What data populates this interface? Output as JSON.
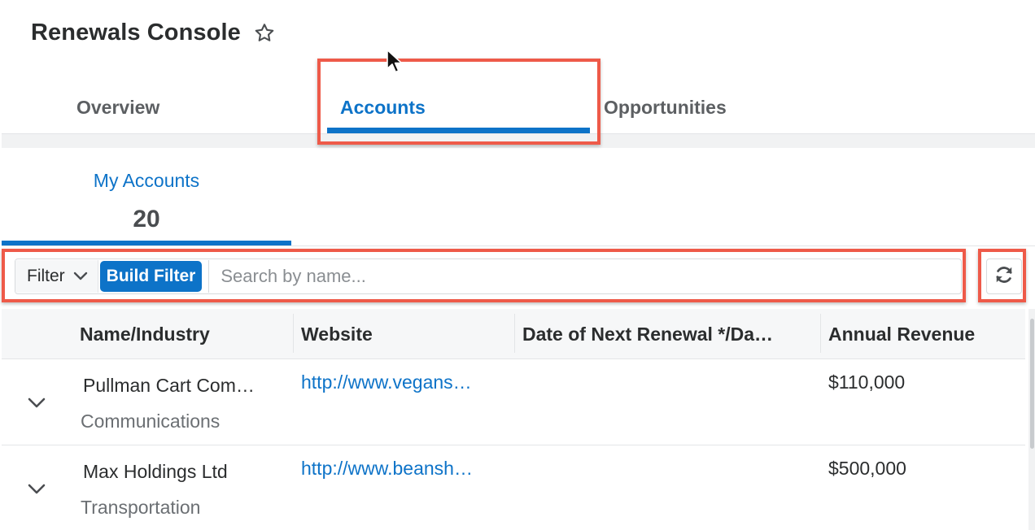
{
  "header": {
    "title": "Renewals Console"
  },
  "tabs": [
    {
      "label": "Overview",
      "active": false
    },
    {
      "label": "Accounts",
      "active": true
    },
    {
      "label": "Opportunities",
      "active": false
    }
  ],
  "summary": {
    "label": "My Accounts",
    "count": "20"
  },
  "filter_bar": {
    "filter_label": "Filter",
    "build_filter_label": "Build Filter",
    "search_placeholder": "Search by name..."
  },
  "table": {
    "columns": [
      "Name/Industry",
      "Website",
      "Date of Next Renewal */Da…",
      "Annual Revenue"
    ],
    "rows": [
      {
        "name": "Pullman Cart Com…",
        "industry": "Communications",
        "website": "http://www.vegans…",
        "renewal_date": "",
        "revenue": "$110,000"
      },
      {
        "name": "Max Holdings Ltd",
        "industry": "Transportation",
        "website": "http://www.beansh…",
        "renewal_date": "",
        "revenue": "$500,000"
      }
    ]
  },
  "colors": {
    "accent": "#0d73c8",
    "annotation": "#ee5a49",
    "text": "#2b2d2e"
  },
  "icons": [
    "star-icon",
    "cursor-icon",
    "chevron-down-icon",
    "refresh-icon"
  ]
}
